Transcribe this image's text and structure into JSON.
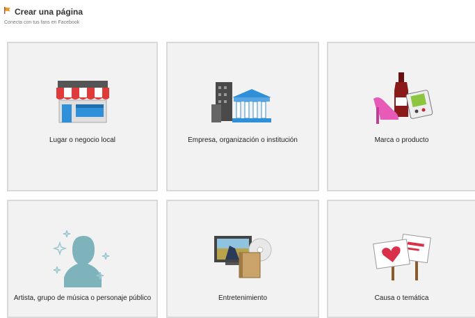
{
  "header": {
    "title": "Crear una página",
    "subtitle": "Conecta con tus fans en Facebook"
  },
  "categories": [
    {
      "label": "Lugar o negocio local",
      "icon": "store-icon"
    },
    {
      "label": "Empresa, organización o institución",
      "icon": "building-icon"
    },
    {
      "label": "Marca o producto",
      "icon": "brand-products-icon"
    },
    {
      "label": "Artista, grupo de música o personaje público",
      "icon": "artist-silhouette-icon"
    },
    {
      "label": "Entretenimiento",
      "icon": "entertainment-icon"
    },
    {
      "label": "Causa o temática",
      "icon": "cause-signs-icon"
    }
  ],
  "colors": {
    "tile_background": "#f2f2f2",
    "tile_border": "#d9d9d9",
    "awning_red": "#e03b3b",
    "store_blue": "#2f8fd8",
    "shoe_pink": "#e85ab8",
    "bottle_red": "#8a1a1a",
    "silhouette_teal": "#7fb3bb",
    "heart_red": "#d9314a"
  }
}
